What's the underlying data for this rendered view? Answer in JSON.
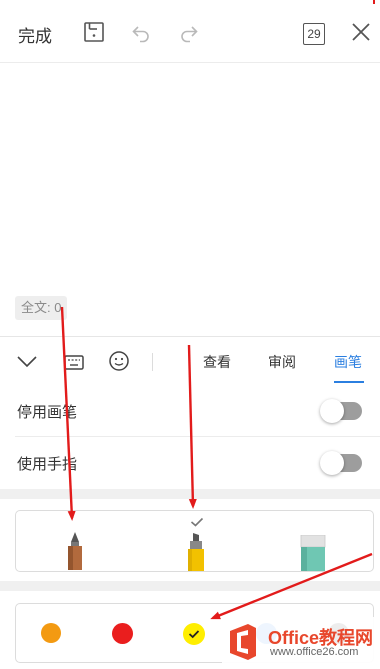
{
  "topbar": {
    "done_label": "完成",
    "page_count": "29"
  },
  "document": {
    "word_count": "全文: 0"
  },
  "toolbar": {
    "tabs": [
      "查看",
      "审阅",
      "画笔"
    ],
    "active_tab": "画笔"
  },
  "settings": {
    "disable_pen_label": "停用画笔",
    "use_finger_label": "使用手指",
    "disable_pen_on": false,
    "use_finger_on": false
  },
  "pens": {
    "items": [
      "pencil",
      "highlighter",
      "eraser"
    ],
    "selected": "highlighter"
  },
  "colors": {
    "swatches": [
      "#f39a12",
      "#ea1e1e",
      "#ffee00",
      "#2a86e8",
      "#1a1a1a"
    ],
    "selected_index": 2
  },
  "watermark": {
    "brand": "Office教程网",
    "url": "www.office26.com"
  },
  "accent_color": "#2b7fe0"
}
